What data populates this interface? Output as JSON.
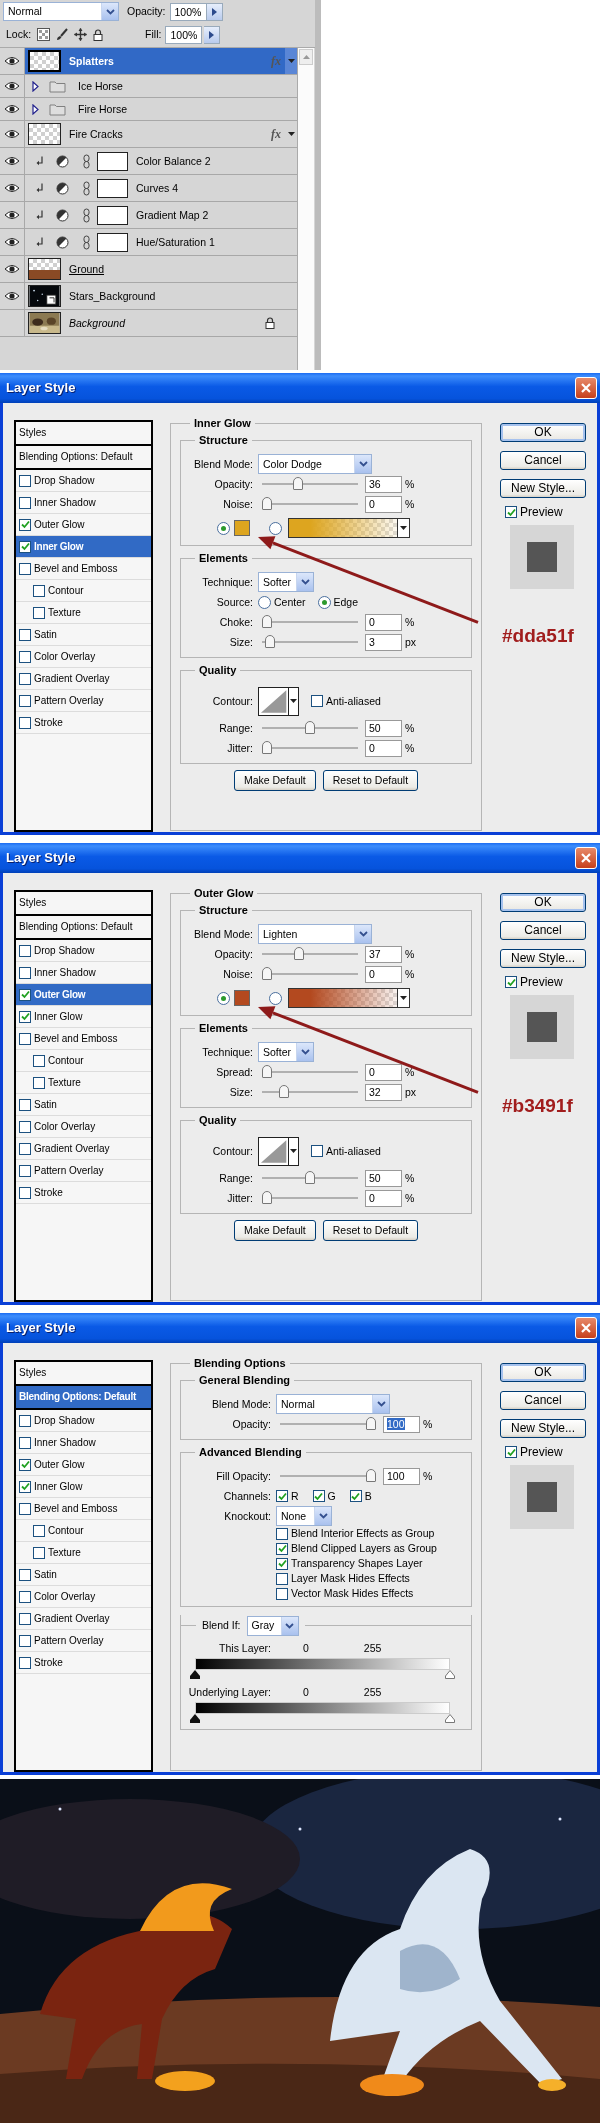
{
  "layers_panel": {
    "blend_mode": "Normal",
    "opacity_label": "Opacity:",
    "opacity": "100%",
    "lock_label": "Lock:",
    "fill_label": "Fill:",
    "fill": "100%",
    "layers": [
      {
        "kind": "layer",
        "name": "Splatters",
        "thumbnail": {
          "kind": "checker"
        },
        "visible": true,
        "selected": true,
        "underlined": false,
        "effects": "fx"
      },
      {
        "kind": "group",
        "name": "Ice Horse",
        "visible": true,
        "selected": false,
        "underlined": false
      },
      {
        "kind": "group",
        "name": "Fire Horse",
        "visible": true,
        "selected": false,
        "underlined": false
      },
      {
        "kind": "layer",
        "name": "Fire Cracks",
        "thumbnail": {
          "kind": "checker"
        },
        "visible": true,
        "selected": false,
        "underlined": false,
        "effects": "fx"
      },
      {
        "kind": "adjustment",
        "name": "Color Balance 2",
        "visible": true,
        "selected": false,
        "underlined": false
      },
      {
        "kind": "adjustment",
        "name": "Curves 4",
        "visible": true,
        "selected": false,
        "underlined": false
      },
      {
        "kind": "adjustment",
        "name": "Gradient Map 2",
        "visible": true,
        "selected": false,
        "underlined": false
      },
      {
        "kind": "adjustment",
        "name": "Hue/Saturation 1",
        "visible": true,
        "selected": false,
        "underlined": false
      },
      {
        "kind": "layer",
        "name": "Ground",
        "thumbnail": {
          "kind": "ground"
        },
        "visible": true,
        "selected": false,
        "underlined": true
      },
      {
        "kind": "smart",
        "name": "Stars_Background",
        "thumbnail": {
          "kind": "stars"
        },
        "visible": true,
        "selected": false,
        "underlined": false
      },
      {
        "kind": "background",
        "name": "Background",
        "visible": false,
        "selected": false,
        "underlined": false
      }
    ]
  },
  "dialogs": [
    {
      "title": "Layer Style",
      "styles_label": "Styles",
      "style_items": [
        {
          "kind": "header",
          "label": "Blending Options: Default",
          "selected": false
        },
        {
          "kind": "check",
          "label": "Drop Shadow",
          "checked": false,
          "selected": false
        },
        {
          "kind": "check",
          "label": "Inner Shadow",
          "checked": false,
          "selected": false
        },
        {
          "kind": "check",
          "label": "Outer Glow",
          "checked": true,
          "selected": false
        },
        {
          "kind": "check",
          "label": "Inner Glow",
          "checked": true,
          "selected": true
        },
        {
          "kind": "check",
          "label": "Bevel and Emboss",
          "checked": false,
          "selected": false
        },
        {
          "kind": "sub",
          "label": "Contour",
          "checked": false,
          "selected": false
        },
        {
          "kind": "sub",
          "label": "Texture",
          "checked": false,
          "selected": false
        },
        {
          "kind": "check",
          "label": "Satin",
          "checked": false,
          "selected": false
        },
        {
          "kind": "check",
          "label": "Color Overlay",
          "checked": false,
          "selected": false
        },
        {
          "kind": "check",
          "label": "Gradient Overlay",
          "checked": false,
          "selected": false
        },
        {
          "kind": "check",
          "label": "Pattern Overlay",
          "checked": false,
          "selected": false
        },
        {
          "kind": "check",
          "label": "Stroke",
          "checked": false,
          "selected": false
        }
      ],
      "section": "Inner Glow",
      "groups": [
        {
          "title": "Structure",
          "rows": [
            {
              "kind": "dropdown",
              "label": "Blend Mode:",
              "value": "Color Dodge"
            },
            {
              "kind": "slider",
              "label": "Opacity:",
              "level": 0.36,
              "value": "36",
              "unit": "%",
              "highlighted": false
            },
            {
              "kind": "slider",
              "label": "Noise:",
              "level": 0,
              "value": "0",
              "unit": "%",
              "highlighted": false
            },
            {
              "kind": "color",
              "options": [
                {
                  "kind": "swatch",
                  "selected": true,
                  "color": "#dda51f"
                },
                {
                  "kind": "gradient",
                  "selected": false,
                  "color": "#dda51f"
                }
              ]
            }
          ]
        },
        {
          "title": "Elements",
          "rows": [
            {
              "kind": "short_dropdown",
              "label": "Technique:",
              "value": "Softer"
            },
            {
              "kind": "radio",
              "label": "Source:",
              "options": [
                {
                  "label": "Center",
                  "selected": false
                },
                {
                  "label": "Edge",
                  "selected": true
                }
              ]
            },
            {
              "kind": "slider",
              "label": "Choke:",
              "level": 0,
              "value": "0",
              "unit": "%",
              "highlighted": false
            },
            {
              "kind": "slider",
              "label": "Size:",
              "level": 0.03,
              "value": "3",
              "unit": "px",
              "highlighted": false
            }
          ]
        },
        {
          "title": "Quality",
          "rows": [
            {
              "kind": "contour",
              "label": "Contour:",
              "check_label": "Anti-aliased",
              "checked": false
            },
            {
              "kind": "slider",
              "label": "Range:",
              "level": 0.5,
              "value": "50",
              "unit": "%",
              "highlighted": false
            },
            {
              "kind": "slider",
              "label": "Jitter:",
              "level": 0,
              "value": "0",
              "unit": "%",
              "highlighted": false
            }
          ]
        }
      ],
      "footer_buttons": [
        "Make Default",
        "Reset to Default"
      ],
      "buttons": [
        "OK",
        "Cancel",
        "New Style..."
      ],
      "preview": {
        "label": "Preview",
        "checked": true
      },
      "annotation": "#dda51f"
    },
    {
      "title": "Layer Style",
      "styles_label": "Styles",
      "style_items": [
        {
          "kind": "header",
          "label": "Blending Options: Default",
          "selected": false
        },
        {
          "kind": "check",
          "label": "Drop Shadow",
          "checked": false,
          "selected": false
        },
        {
          "kind": "check",
          "label": "Inner Shadow",
          "checked": false,
          "selected": false
        },
        {
          "kind": "check",
          "label": "Outer Glow",
          "checked": true,
          "selected": true
        },
        {
          "kind": "check",
          "label": "Inner Glow",
          "checked": true,
          "selected": false
        },
        {
          "kind": "check",
          "label": "Bevel and Emboss",
          "checked": false,
          "selected": false
        },
        {
          "kind": "sub",
          "label": "Contour",
          "checked": false,
          "selected": false
        },
        {
          "kind": "sub",
          "label": "Texture",
          "checked": false,
          "selected": false
        },
        {
          "kind": "check",
          "label": "Satin",
          "checked": false,
          "selected": false
        },
        {
          "kind": "check",
          "label": "Color Overlay",
          "checked": false,
          "selected": false
        },
        {
          "kind": "check",
          "label": "Gradient Overlay",
          "checked": false,
          "selected": false
        },
        {
          "kind": "check",
          "label": "Pattern Overlay",
          "checked": false,
          "selected": false
        },
        {
          "kind": "check",
          "label": "Stroke",
          "checked": false,
          "selected": false
        }
      ],
      "section": "Outer Glow",
      "groups": [
        {
          "title": "Structure",
          "rows": [
            {
              "kind": "dropdown",
              "label": "Blend Mode:",
              "value": "Lighten"
            },
            {
              "kind": "slider",
              "label": "Opacity:",
              "level": 0.37,
              "value": "37",
              "unit": "%",
              "highlighted": false
            },
            {
              "kind": "slider",
              "label": "Noise:",
              "level": 0,
              "value": "0",
              "unit": "%",
              "highlighted": false
            },
            {
              "kind": "color",
              "options": [
                {
                  "kind": "swatch",
                  "selected": true,
                  "color": "#b3491f"
                },
                {
                  "kind": "gradient",
                  "selected": false,
                  "color": "#b3491f"
                }
              ]
            }
          ]
        },
        {
          "title": "Elements",
          "rows": [
            {
              "kind": "short_dropdown",
              "label": "Technique:",
              "value": "Softer"
            },
            {
              "kind": "slider",
              "label": "Spread:",
              "level": 0,
              "value": "0",
              "unit": "%",
              "highlighted": false
            },
            {
              "kind": "slider",
              "label": "Size:",
              "level": 0.2,
              "value": "32",
              "unit": "px",
              "highlighted": false
            }
          ]
        },
        {
          "title": "Quality",
          "rows": [
            {
              "kind": "contour",
              "label": "Contour:",
              "check_label": "Anti-aliased",
              "checked": false
            },
            {
              "kind": "slider",
              "label": "Range:",
              "level": 0.5,
              "value": "50",
              "unit": "%",
              "highlighted": false
            },
            {
              "kind": "slider",
              "label": "Jitter:",
              "level": 0,
              "value": "0",
              "unit": "%",
              "highlighted": false
            }
          ]
        }
      ],
      "footer_buttons": [
        "Make Default",
        "Reset to Default"
      ],
      "buttons": [
        "OK",
        "Cancel",
        "New Style..."
      ],
      "preview": {
        "label": "Preview",
        "checked": true
      },
      "annotation": "#b3491f"
    },
    {
      "title": "Layer Style",
      "styles_label": "Styles",
      "style_items": [
        {
          "kind": "header",
          "label": "Blending Options: Default",
          "selected": true
        },
        {
          "kind": "check",
          "label": "Drop Shadow",
          "checked": false,
          "selected": false
        },
        {
          "kind": "check",
          "label": "Inner Shadow",
          "checked": false,
          "selected": false
        },
        {
          "kind": "check",
          "label": "Outer Glow",
          "checked": true,
          "selected": false
        },
        {
          "kind": "check",
          "label": "Inner Glow",
          "checked": true,
          "selected": false
        },
        {
          "kind": "check",
          "label": "Bevel and Emboss",
          "checked": false,
          "selected": false
        },
        {
          "kind": "sub",
          "label": "Contour",
          "checked": false,
          "selected": false
        },
        {
          "kind": "sub",
          "label": "Texture",
          "checked": false,
          "selected": false
        },
        {
          "kind": "check",
          "label": "Satin",
          "checked": false,
          "selected": false
        },
        {
          "kind": "check",
          "label": "Color Overlay",
          "checked": false,
          "selected": false
        },
        {
          "kind": "check",
          "label": "Gradient Overlay",
          "checked": false,
          "selected": false
        },
        {
          "kind": "check",
          "label": "Pattern Overlay",
          "checked": false,
          "selected": false
        },
        {
          "kind": "check",
          "label": "Stroke",
          "checked": false,
          "selected": false
        }
      ],
      "section": "Blending Options",
      "groups": [
        {
          "title": "General Blending",
          "rows": [
            {
              "kind": "dropdown",
              "label": "Blend Mode:",
              "value": "Normal"
            },
            {
              "kind": "slider",
              "label": "Opacity:",
              "level": 1,
              "value": "100",
              "unit": "%",
              "highlighted": true
            }
          ]
        },
        {
          "title": "Advanced Blending",
          "rows": [
            {
              "kind": "slider",
              "label": "Fill Opacity:",
              "level": 1,
              "value": "100",
              "unit": "%",
              "highlighted": false
            },
            {
              "kind": "channels",
              "label": "Channels:",
              "options": [
                {
                  "label": "R",
                  "checked": true
                },
                {
                  "label": "G",
                  "checked": true
                },
                {
                  "label": "B",
                  "checked": true
                }
              ]
            },
            {
              "kind": "short_dropdown",
              "label": "Knockout:",
              "value": "None"
            },
            {
              "kind": "check",
              "label": "Blend Interior Effects as Group",
              "checked": false
            },
            {
              "kind": "check",
              "label": "Blend Clipped Layers as Group",
              "checked": true
            },
            {
              "kind": "check",
              "label": "Transparency Shapes Layer",
              "checked": true
            },
            {
              "kind": "check",
              "label": "Layer Mask Hides Effects",
              "checked": false
            },
            {
              "kind": "check",
              "label": "Vector Mask Hides Effects",
              "checked": false
            }
          ]
        },
        {
          "legend_select": {
            "label": "Blend If:",
            "value": "Gray"
          },
          "rows": [
            {
              "kind": "range",
              "label": "This Layer:",
              "low": "0",
              "high": "255",
              "handles": [
                {
                  "level": 0
                },
                {
                  "level": 1
                }
              ]
            },
            {
              "kind": "range",
              "label": "Underlying Layer:",
              "low": "0",
              "high": "255",
              "handles": [
                {
                  "level": 0
                },
                {
                  "level": 1
                }
              ]
            }
          ]
        }
      ],
      "buttons": [
        "OK",
        "Cancel",
        "New Style..."
      ],
      "preview": {
        "label": "Preview",
        "checked": true
      }
    }
  ]
}
